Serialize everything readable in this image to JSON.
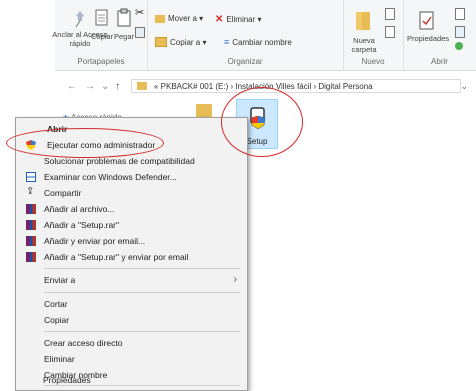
{
  "ribbon": {
    "clipboard": {
      "pin_label": "Anclar al Acceso rápido",
      "copy_label": "Copiar",
      "paste_label": "Pegar",
      "group_label": "Portapapeles"
    },
    "organize": {
      "move_label": "Mover a ▾",
      "delete_label": "Eliminar ▾",
      "copy_to_label": "Copiar a ▾",
      "rename_label": "Cambiar nombre",
      "group_label": "Organizar"
    },
    "new": {
      "new_folder_label": "Nueva carpeta",
      "group_label": "Nuevo"
    },
    "open": {
      "properties_label": "Propiedades",
      "group_label": "Abrir"
    }
  },
  "address": {
    "back": "←",
    "forward": "→",
    "recent": "⌄",
    "up": "↑",
    "path": "«  PKBACK# 001 (E:)  ›  Instalación Villes fácil  ›  Digital Persona",
    "chevron": "⌄"
  },
  "sidebar": {
    "quick_access": "Acceso rápido"
  },
  "files": {
    "setup_label": "Setup"
  },
  "context_menu": {
    "items": [
      {
        "label": "Abrir"
      },
      {
        "label": "Ejecutar como administrador"
      },
      {
        "label": "Solucionar problemas de compatibilidad"
      },
      {
        "label": "Examinar con Windows Defender..."
      },
      {
        "label": "Compartir"
      },
      {
        "label": "Añadir al archivo..."
      },
      {
        "label": "Añadir a \"Setup.rar\""
      },
      {
        "label": "Añadir y enviar por email..."
      },
      {
        "label": "Añadir a \"Setup.rar\" y enviar por email"
      },
      {
        "label": "Enviar a"
      },
      {
        "label": "Cortar"
      },
      {
        "label": "Copiar"
      },
      {
        "label": "Crear acceso directo"
      },
      {
        "label": "Eliminar"
      },
      {
        "label": "Cambiar nombre"
      },
      {
        "label": "Propiedades"
      }
    ],
    "submenu_arrow": "›"
  },
  "colors": {
    "annotation": "#d62a2a",
    "selection": "#cce8ff",
    "menu_bg": "#f2f2f2"
  }
}
